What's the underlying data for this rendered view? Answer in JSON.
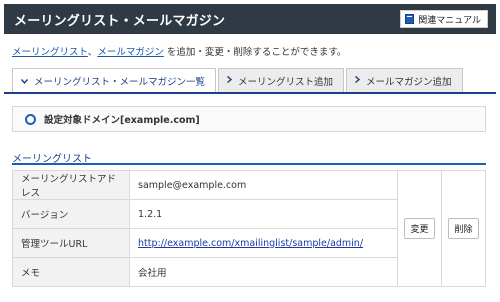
{
  "header": {
    "title": "メーリングリスト・メールマガジン",
    "manual_button": "関連マニュアル"
  },
  "intro": {
    "link_mailinglist": "メーリングリスト",
    "separator": "、",
    "link_magazine": "メールマガジン",
    "text": "を追加・変更・削除することができます。"
  },
  "tabs": [
    {
      "label": "メーリングリスト・メールマガジン一覧",
      "active": true
    },
    {
      "label": "メーリングリスト追加",
      "active": false
    },
    {
      "label": "メールマガジン追加",
      "active": false
    }
  ],
  "domain": {
    "label": "設定対象ドメイン[example.com]"
  },
  "section": {
    "title": "メーリングリスト"
  },
  "table": {
    "rows": [
      {
        "label": "メーリングリストアドレス",
        "value": "sample@example.com"
      },
      {
        "label": "バージョン",
        "value": "1.2.1"
      },
      {
        "label": "管理ツールURL",
        "value": "http://example.com/xmailinglist/sample/admin/"
      },
      {
        "label": "メモ",
        "value": "会社用"
      }
    ],
    "edit_button": "変更",
    "delete_button": "削除"
  },
  "colors": {
    "header_bg": "#2f3a44",
    "accent": "#1b5fb5",
    "link": "#1a55a8"
  }
}
